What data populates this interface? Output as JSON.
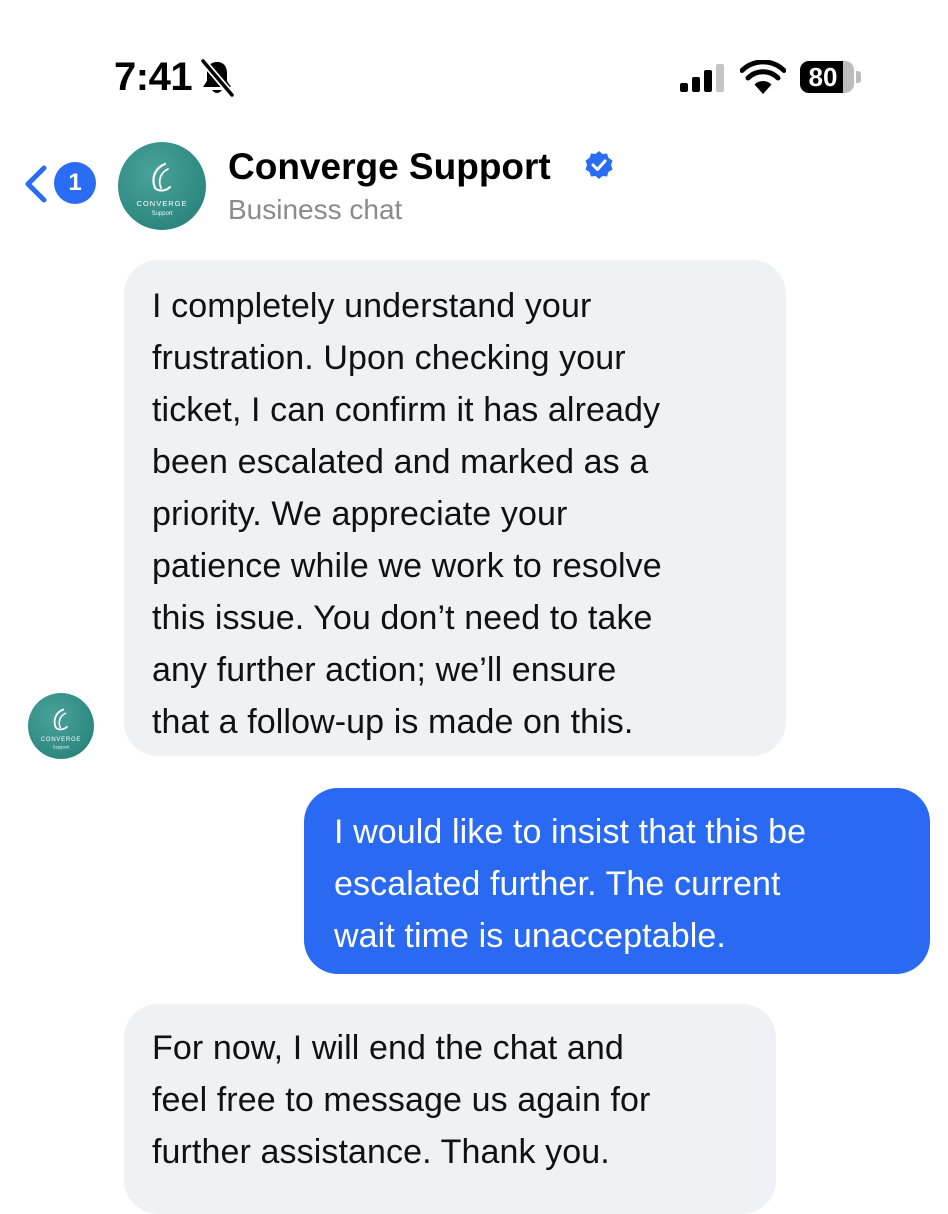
{
  "status_bar": {
    "time": "7:41",
    "battery": "80",
    "battery_level": 0.8,
    "icons": [
      "bell-off-icon",
      "cellular-signal-icon",
      "wifi-icon",
      "battery-icon"
    ]
  },
  "header": {
    "back_icon": "chevron-left-icon",
    "unread_count": "1",
    "title": "Converge Support",
    "verified_icon": "verified-badge-icon",
    "subtitle": "Business chat",
    "avatar": {
      "brand_text": "CONVERGE",
      "brand_subtext": "Support"
    }
  },
  "messages": [
    {
      "direction": "incoming",
      "lines": [
        "I completely understand your",
        "frustration. Upon checking your",
        "ticket, I can confirm it has already",
        "been escalated and marked as a",
        "priority. We appreciate your",
        "patience while we work to resolve",
        "this issue. You don’t need to take",
        "any further action; we’ll ensure",
        "that a follow-up is made on this."
      ]
    },
    {
      "direction": "outgoing",
      "lines": [
        "I would like to insist that this be",
        "escalated further. The current",
        "wait time is unacceptable."
      ]
    },
    {
      "direction": "incoming",
      "lines": [
        "For now, I will end the chat and",
        "feel free to message us again for",
        "further assistance. Thank you."
      ]
    }
  ],
  "colors": {
    "accent": "#2a6df4",
    "outgoing_bubble": "#2a6af2",
    "incoming_bubble": "#f0f1f5",
    "brand_teal": "#2f8a82",
    "subtitle_gray": "#8a8a8e"
  }
}
